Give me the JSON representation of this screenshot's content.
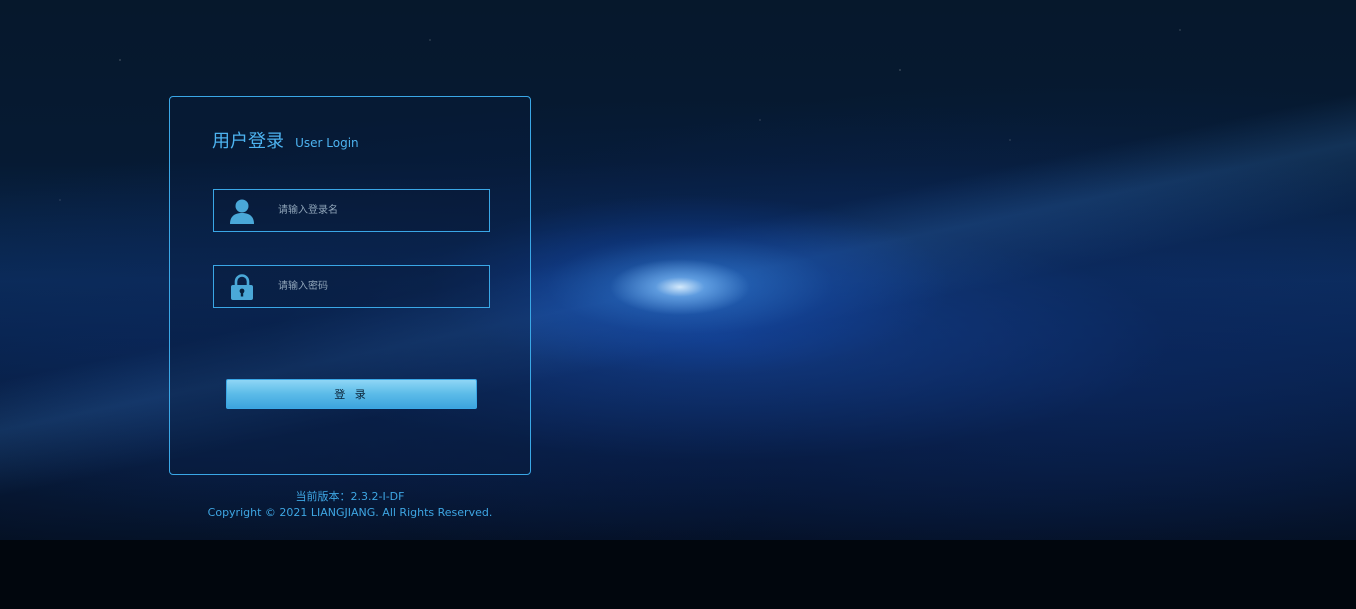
{
  "login": {
    "title_cn": "用户登录",
    "title_en": "User Login",
    "username": {
      "placeholder": "请输入登录名",
      "value": "",
      "icon": "user-icon"
    },
    "password": {
      "placeholder": "请输入密码",
      "value": "",
      "icon": "lock-icon"
    },
    "submit_label": "登 录"
  },
  "footer": {
    "version": "当前版本：2.3.2-I-DF",
    "copyright": "Copyright © 2021 LIANGJIANG. All Rights Reserved."
  },
  "colors": {
    "accent": "#3aa7e6",
    "button_top": "#8fd6f6",
    "button_bottom": "#3da4de",
    "icon": "#4aa8d8"
  }
}
